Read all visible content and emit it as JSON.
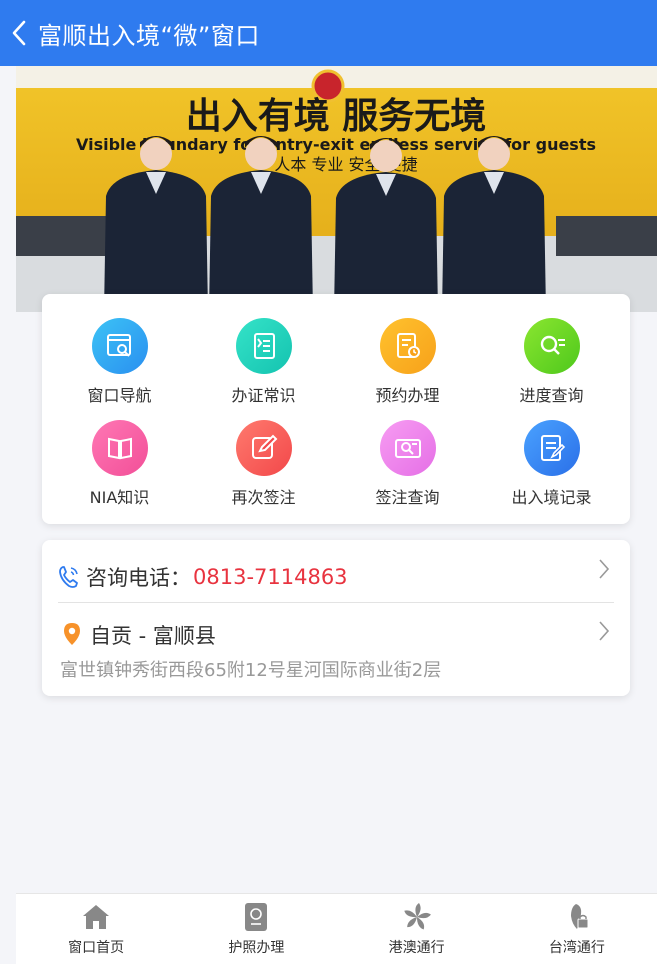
{
  "header": {
    "title": "富顺出入境“微”窗口"
  },
  "banner": {
    "slogan_cn": "出入有境 服务无境",
    "slogan_en": "Visible boundary for entry-exit endless service for guests",
    "motto": "人本 专业 安全 便捷"
  },
  "grid": {
    "items": [
      {
        "label": "窗口导航",
        "icon": "window-nav-icon",
        "color_a": "#3cc3f5",
        "color_b": "#2a8ff0"
      },
      {
        "label": "办证常识",
        "icon": "document-knowledge-icon",
        "color_a": "#35e3c8",
        "color_b": "#14c3b0"
      },
      {
        "label": "预约办理",
        "icon": "appointment-icon",
        "color_a": "#ffc22e",
        "color_b": "#f7a11a"
      },
      {
        "label": "进度查询",
        "icon": "progress-search-icon",
        "color_a": "#8be630",
        "color_b": "#4ec81c"
      },
      {
        "label": "NIA知识",
        "icon": "book-icon",
        "color_a": "#ff77b4",
        "color_b": "#f24f98"
      },
      {
        "label": "再次签注",
        "icon": "edit-sign-icon",
        "color_a": "#ff7a6e",
        "color_b": "#f2484a"
      },
      {
        "label": "签注查询",
        "icon": "endorsement-query-icon",
        "color_a": "#f79cf2",
        "color_b": "#e56fe6"
      },
      {
        "label": "出入境记录",
        "icon": "record-icon",
        "color_a": "#4aa2ff",
        "color_b": "#2a6fe8"
      }
    ]
  },
  "contact": {
    "phone_label": "咨询电话：",
    "phone_number": "0813-7114863",
    "city": "自贡 - 富顺县",
    "address": "富世镇钟秀街西段65附12号星河国际商业街2层"
  },
  "tabbar": {
    "items": [
      {
        "label": "窗口首页",
        "icon": "home-icon"
      },
      {
        "label": "护照办理",
        "icon": "passport-icon"
      },
      {
        "label": "港澳通行",
        "icon": "bauhinia-icon"
      },
      {
        "label": "台湾通行",
        "icon": "taiwan-icon"
      }
    ]
  }
}
